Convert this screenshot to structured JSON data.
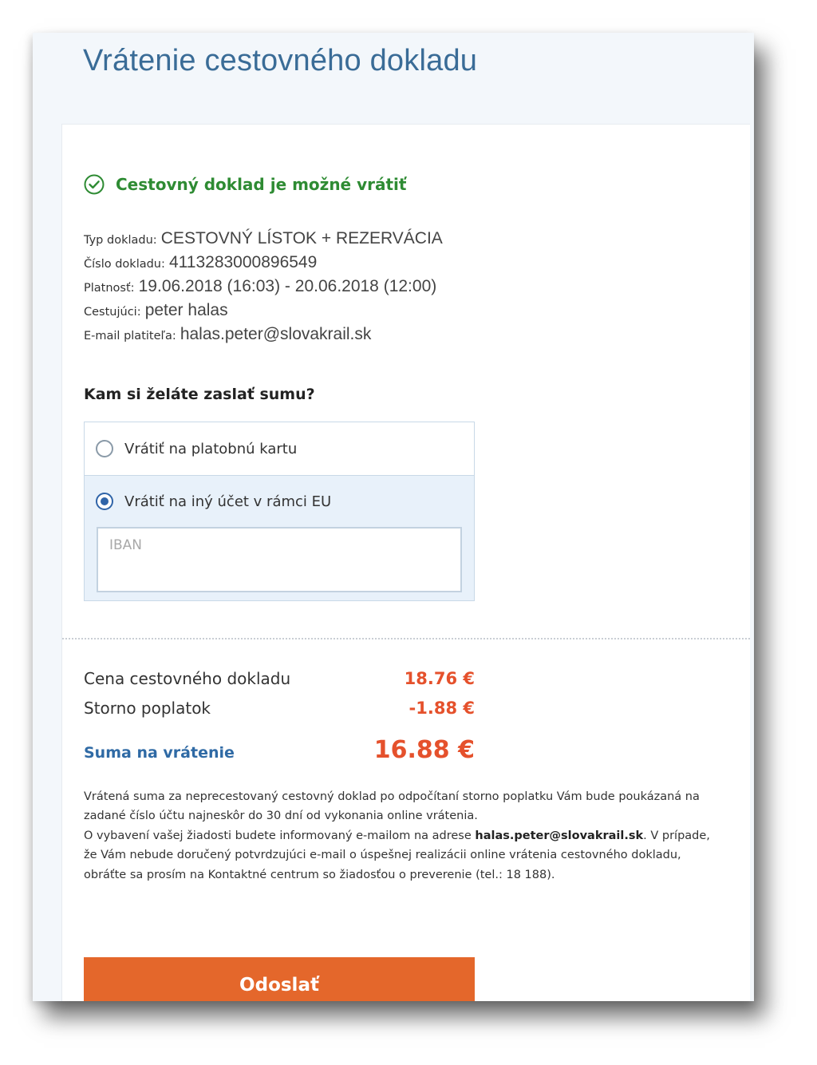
{
  "page": {
    "title": "Vrátenie cestovného dokladu"
  },
  "status": {
    "icon": "check-circle-icon",
    "text": "Cestovný doklad je možné vrátiť",
    "color": "#2e8b33"
  },
  "details": [
    {
      "label": "Typ dokladu:",
      "value": "CESTOVNÝ LÍSTOK + REZERVÁCIA"
    },
    {
      "label": "Číslo dokladu:",
      "value": "4113283000896549"
    },
    {
      "label": "Platnosť:",
      "value": "19.06.2018 (16:03) - 20.06.2018 (12:00)"
    },
    {
      "label": "Cestujúci:",
      "value": "peter halas"
    },
    {
      "label": "E-mail platiteľa:",
      "value": "halas.peter@slovakrail.sk"
    }
  ],
  "refund": {
    "question": "Kam si želáte zaslať sumu?",
    "options": [
      {
        "label": "Vrátiť na platobnú kartu",
        "selected": false
      },
      {
        "label": "Vrátiť na iný účet v rámci EU",
        "selected": true
      }
    ],
    "iban": {
      "placeholder": "IBAN",
      "value": ""
    }
  },
  "prices": {
    "ticket_price_label": "Cena cestovného dokladu",
    "ticket_price_value": "18.76 €",
    "storno_label": "Storno poplatok",
    "storno_value": "-1.88 €",
    "total_label": "Suma na vrátenie",
    "total_value": "16.88 €",
    "accent_color": "#e5512c"
  },
  "info": {
    "text_part1": "Vrátená suma za neprecestovaný cestovný doklad po odpočítaní storno poplatku Vám bude poukázaná na zadané číslo účtu najneskôr do 30 dní od vykonania online vrátenia.",
    "text_part2": "O vybavení vašej žiadosti budete informovaný e-mailom na adrese ",
    "email": "halas.peter@slovakrail.sk",
    "text_part3": ". V prípade, že Vám nebude doručený potvrdzujúci e-mail o úspešnej realizácii online vrátenia cestovného dokladu, obráťte sa prosím na Kontaktné centrum so žiadosťou o preverenie (tel.: 18 188)."
  },
  "actions": {
    "submit_label": "Odoslať",
    "submit_color": "#e4672b"
  }
}
